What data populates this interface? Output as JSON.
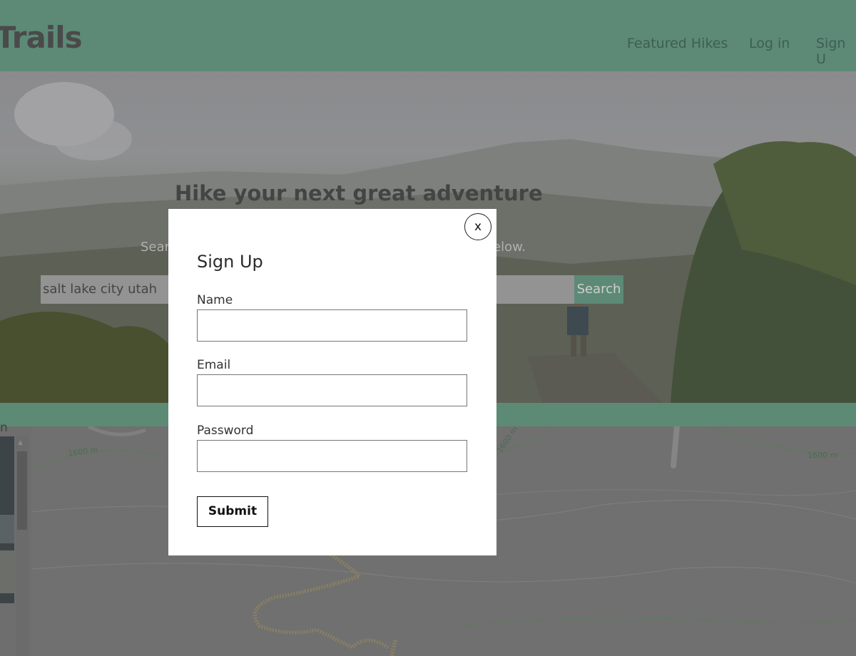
{
  "header": {
    "logo_text": "rTrails",
    "nav": [
      "Featured Hikes",
      "Log in",
      "Sign U"
    ]
  },
  "hero": {
    "title": "Hike your next great adventure",
    "subtitle_left": "Sear",
    "subtitle_right": "elow.",
    "search_value": "salt lake city utah",
    "search_button": "Search"
  },
  "results_label": "n",
  "map": {
    "contour_labels": [
      "1600 m",
      "1600 m",
      "1600 m"
    ]
  },
  "modal": {
    "close_label": "x",
    "title": "Sign Up",
    "fields": [
      {
        "label": "Name",
        "value": ""
      },
      {
        "label": "Email",
        "value": ""
      },
      {
        "label": "Password",
        "value": ""
      }
    ],
    "submit_label": "Submit"
  }
}
